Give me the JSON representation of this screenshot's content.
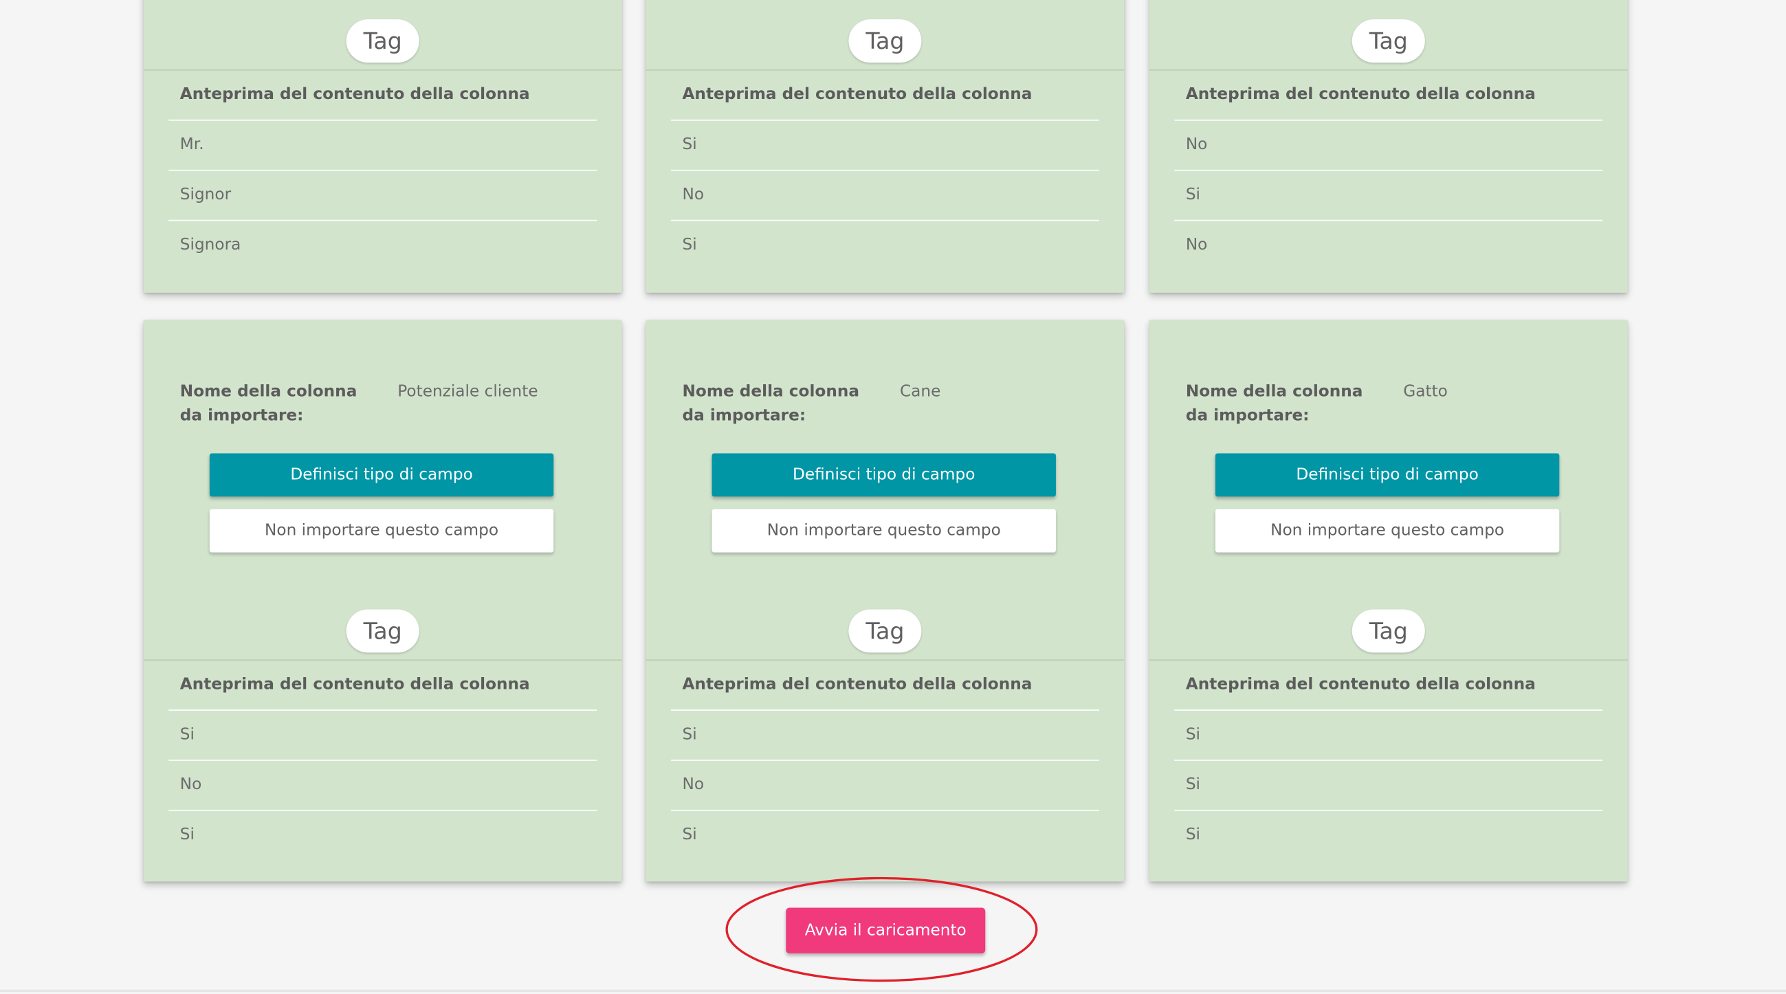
{
  "tag_label": "Tag",
  "preview_header": "Anteprima del contenuto della colonna",
  "column_name_label": "Nome della colonna da importare:",
  "define_button_label": "Definisci tipo di campo",
  "skip_button_label": "Non importare questo campo",
  "start_button_label": "Avvia il caricamento",
  "accent_colors": {
    "card_background": "#d3e4cd",
    "define_button": "#0096a6",
    "start_button": "#f03a7c",
    "annotation_circle": "#e0202a"
  },
  "top_cards": [
    {
      "preview": [
        "Mr.",
        "Signor",
        "Signora"
      ]
    },
    {
      "preview": [
        "Si",
        "No",
        "Si"
      ]
    },
    {
      "preview": [
        "No",
        "Si",
        "No"
      ]
    }
  ],
  "bottom_cards": [
    {
      "column_name": "Potenziale cliente",
      "preview": [
        "Si",
        "No",
        "Si"
      ]
    },
    {
      "column_name": "Cane",
      "preview": [
        "Si",
        "No",
        "Si"
      ]
    },
    {
      "column_name": "Gatto",
      "preview": [
        "Si",
        "Si",
        "Si"
      ]
    }
  ]
}
